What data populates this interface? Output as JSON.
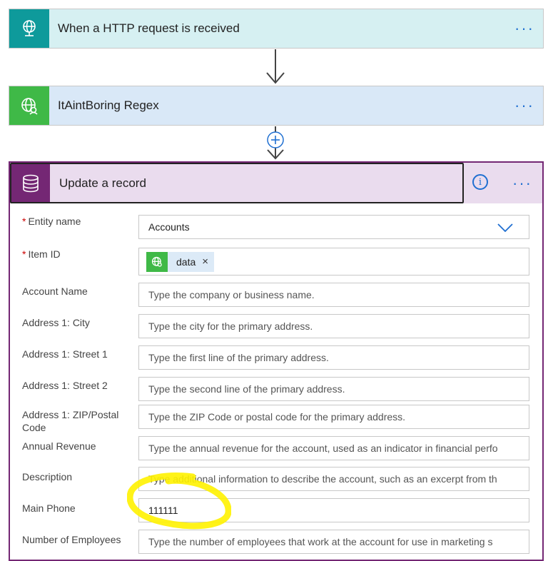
{
  "trigger": {
    "title": "When a HTTP request is received",
    "more": "···"
  },
  "regex": {
    "title": "ItAintBoring Regex",
    "more": "···"
  },
  "update": {
    "title": "Update a record",
    "more": "···",
    "info": "i",
    "fields": [
      {
        "label": "Entity name",
        "required": true,
        "value": "Accounts",
        "type": "dropdown"
      },
      {
        "label": "Item ID",
        "required": true,
        "type": "token",
        "token": "data",
        "token_remove": "×"
      },
      {
        "label": "Account Name",
        "placeholder": "Type the company or business name."
      },
      {
        "label": "Address 1: City",
        "placeholder": "Type the city for the primary address."
      },
      {
        "label": "Address 1: Street 1",
        "placeholder": "Type the first line of the primary address."
      },
      {
        "label": "Address 1: Street 2",
        "placeholder": "Type the second line of the primary address."
      },
      {
        "label": "Address 1: ZIP/Postal Code",
        "placeholder": "Type the ZIP Code or postal code for the primary address."
      },
      {
        "label": "Annual Revenue",
        "placeholder": "Type the annual revenue for the account, used as an indicator in financial perfo"
      },
      {
        "label": "Description",
        "placeholder": "Type additional information to describe the account, such as an excerpt from th"
      },
      {
        "label": "Main Phone",
        "value": "111111"
      },
      {
        "label": "Number of Employees",
        "placeholder": "Type the number of employees that work at the account for use in marketing s"
      }
    ]
  },
  "colors": {
    "trigger_icon_bg": "#0e9a9b",
    "trigger_card_bg": "#d6f0f2",
    "regex_icon_bg": "#3fb947",
    "regex_card_bg": "#d9e8f7",
    "update_accent": "#742774",
    "update_header_bg": "#eadcee",
    "link_blue": "#1f6fd1",
    "highlight": "#fff200"
  }
}
